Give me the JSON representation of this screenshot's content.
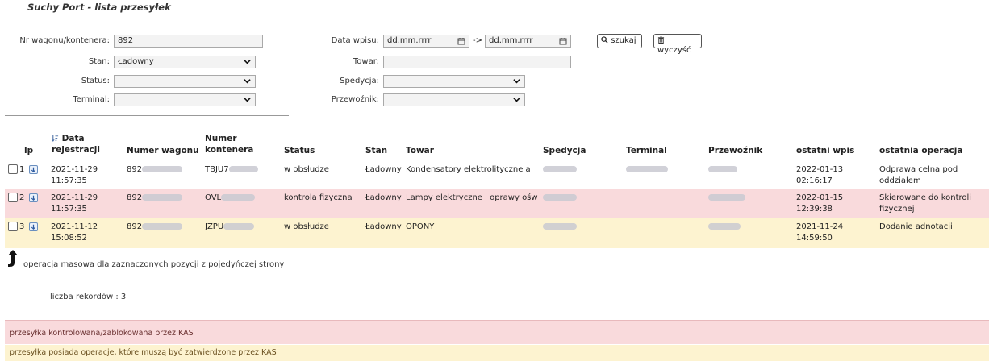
{
  "page": {
    "title": "Suchy Port - lista przesyłek"
  },
  "filters": {
    "wagon_label": "Nr wagonu/kontenera:",
    "wagon_value": "892",
    "stan_label": "Stan:",
    "stan_value": "Ładowny",
    "status_label": "Status:",
    "status_value": "",
    "terminal_label": "Terminal:",
    "terminal_value": "",
    "data_label": "Data wpisu:",
    "date_from_placeholder": "dd.mm.rrrr",
    "date_arrow": "->",
    "date_to_placeholder": "dd.mm.rrrr",
    "towar_label": "Towar:",
    "towar_value": "",
    "spedycja_label": "Spedycja:",
    "spedycja_value": "",
    "przewoznik_label": "Przewoźnik:",
    "przewoznik_value": "",
    "search_label": "szukaj",
    "clear_label": "wyczyść"
  },
  "table": {
    "headers": {
      "lp": "lp",
      "data_line1": "Data",
      "data_line2": "rejestracji",
      "wagon": "Numer wagonu",
      "kontener_line1": "Numer",
      "kontener_line2": "kontenera",
      "status": "Status",
      "stan": "Stan",
      "towar": "Towar",
      "spedycja": "Spedycja",
      "terminal": "Terminal",
      "przewoznik": "Przewoźnik",
      "ostatni_wpis": "ostatni wpis",
      "ostatnia_operacja": "ostatnia operacja"
    },
    "rows": [
      {
        "lp": "1",
        "date1": "2021-11-29",
        "date2": "11:57:35",
        "wagon": "892",
        "kontener": "TBJU7",
        "status": "w obsłudze",
        "stan": "Ładowny",
        "towar": "Kondensatory elektrolityczne a",
        "last1": "2022-01-13",
        "last2": "02:16:17",
        "op1": "Odprawa celna pod oddziałem",
        "op2": ""
      },
      {
        "lp": "2",
        "date1": "2021-11-29",
        "date2": "11:57:35",
        "wagon": "892",
        "kontener": "OVL",
        "status": "kontrola fizyczna",
        "stan": "Ładowny",
        "towar": "Lampy elektryczne i oprawy ośw",
        "last1": "2022-01-15",
        "last2": "12:39:38",
        "op1": "Skierowane do kontroli",
        "op2": "fizycznej"
      },
      {
        "lp": "3",
        "date1": "2021-11-12",
        "date2": "15:08:52",
        "wagon": "892",
        "kontener": "JZPU",
        "status": "w obsłudze",
        "stan": "Ładowny",
        "towar": "OPONY",
        "last1": "2021-11-24",
        "last2": "14:59:50",
        "op1": "Dodanie adnotacji",
        "op2": ""
      }
    ]
  },
  "bulk_operation_text": "operacja masowa dla zaznaczonych pozycji z pojedyńczej strony",
  "records_text": "liczba rekordów : 3",
  "legend": {
    "blocked": "przesyłka kontrolowana/zablokowana przez KAS",
    "pending": "przesyłka posiada operacje, które muszą być zatwierdzone przez KAS"
  },
  "colors": {
    "row_blocked": "#f9dadc",
    "row_pending": "#fdf3d0",
    "input_bg": "#f3f3f3"
  },
  "icons": [
    "calendar-icon",
    "search-icon",
    "trash-icon",
    "chevron-down-icon",
    "sort-icon",
    "expand-icon",
    "arrow-up-icon"
  ]
}
